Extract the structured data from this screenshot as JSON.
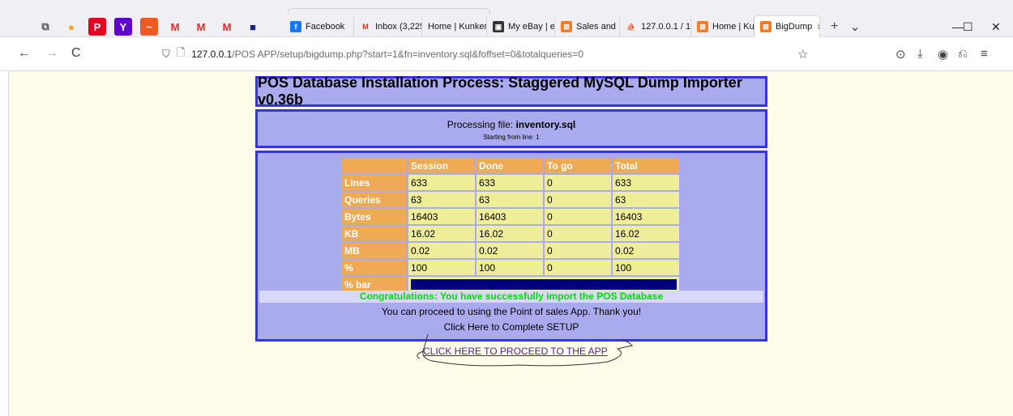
{
  "browser": {
    "pinned": [
      {
        "icon": "tab-list-icon",
        "glyph": "⧉",
        "color": "#555555",
        "bg": "transparent"
      },
      {
        "icon": "badge-icon",
        "glyph": "●",
        "color": "#f5a623",
        "bg": "transparent"
      },
      {
        "icon": "pinterest-icon",
        "glyph": "P",
        "color": "#ffffff",
        "bg": "#e60023"
      },
      {
        "icon": "yahoo-icon",
        "glyph": "Y",
        "color": "#ffffff",
        "bg": "#6001d2"
      },
      {
        "icon": "chart-app-icon",
        "glyph": "~",
        "color": "#ffffff",
        "bg": "#ef5a24"
      },
      {
        "icon": "gmail-icon",
        "glyph": "M",
        "color": "#d93025",
        "bg": "transparent"
      },
      {
        "icon": "gmail-icon",
        "glyph": "M",
        "color": "#d93025",
        "bg": "transparent"
      },
      {
        "icon": "gmail-icon",
        "glyph": "M",
        "color": "#d93025",
        "bg": "transparent"
      },
      {
        "icon": "app-square-icon",
        "glyph": "■",
        "color": "#1a237e",
        "bg": "transparent"
      }
    ],
    "tabs": [
      {
        "label": "Facebook",
        "icon": "facebook-icon",
        "iconbg": "#1877f2",
        "glyph": "f",
        "width": 86
      },
      {
        "label": "Inbox (3,225",
        "icon": "gmail-icon",
        "iconbg": "transparent",
        "glyph": "M",
        "width": 84
      },
      {
        "label": "Home | Kunkem",
        "icon": "none",
        "iconbg": "transparent",
        "glyph": "",
        "width": 80
      },
      {
        "label": "My eBay | el",
        "icon": "ebay-icon",
        "iconbg": "#333333",
        "glyph": "▣",
        "width": 84
      },
      {
        "label": "Sales and In",
        "icon": "xampp-icon",
        "iconbg": "#fb7a24",
        "glyph": "⊠",
        "width": 80
      },
      {
        "label": "127.0.0.1 / 1",
        "icon": "phpmyadmin-icon",
        "iconbg": "transparent",
        "glyph": "⛵",
        "width": 88
      },
      {
        "label": "Home | Kun",
        "icon": "xampp-icon",
        "iconbg": "#fb7a24",
        "glyph": "⊠",
        "width": 78
      },
      {
        "label": "BigDump",
        "icon": "xampp-icon",
        "iconbg": "#fb7a24",
        "glyph": "⊠",
        "width": 80,
        "active": true,
        "close": "×"
      }
    ],
    "new_tab": "+",
    "tab_list": "⌄",
    "win": {
      "min": "—",
      "max": "☐",
      "close": "✕"
    },
    "nav": {
      "back": "←",
      "forward": "→",
      "reload": "C"
    },
    "url": {
      "host": "127.0.0.1",
      "path": "/POS APP/setup/bigdump.php?start=1&fn=inventory.sql&foffset=0&totalqueries=0"
    },
    "toolbar": {
      "bookmark": "☆",
      "pocket": "⊙",
      "download": "⤓",
      "account": "◉",
      "extensions": "⎌",
      "menu": "≡"
    }
  },
  "page": {
    "title": "POS Database Installation Process: Staggered MySQL Dump Importer v0.36b",
    "processing_prefix": "Processing file: ",
    "processing_file": "inventory.sql",
    "starting": "Starting from line: 1",
    "table": {
      "headers": [
        "",
        "Session",
        "Done",
        "To go",
        "Total"
      ],
      "rows": [
        {
          "label": "Lines",
          "values": [
            "633",
            "633",
            "0",
            "633"
          ]
        },
        {
          "label": "Queries",
          "values": [
            "63",
            "63",
            "0",
            "63"
          ]
        },
        {
          "label": "Bytes",
          "values": [
            "16403",
            "16403",
            "0",
            "16403"
          ]
        },
        {
          "label": "KB",
          "values": [
            "16.02",
            "16.02",
            "0",
            "16.02"
          ]
        },
        {
          "label": "MB",
          "values": [
            "0.02",
            "0.02",
            "0",
            "0.02"
          ]
        },
        {
          "label": "%",
          "values": [
            "100",
            "100",
            "0",
            "100"
          ]
        }
      ],
      "bar_label": "% bar",
      "bar_percent": 100
    },
    "congrats": "Congratulations: You have successfully import the POS Database",
    "proceed_msg": "You can proceed to using the Point of sales App. Thank you!",
    "complete_msg": "Click Here to Complete SETUP",
    "link": "CLICK HERE TO PROCEED TO THE APP"
  },
  "colors": {
    "frame_border": "#3333ee",
    "frame_bg": "#aaaaee",
    "header_cell": "#eeaa55",
    "value_cell": "#eeee99",
    "bar": "#000080",
    "congrats": "#00dd00"
  }
}
